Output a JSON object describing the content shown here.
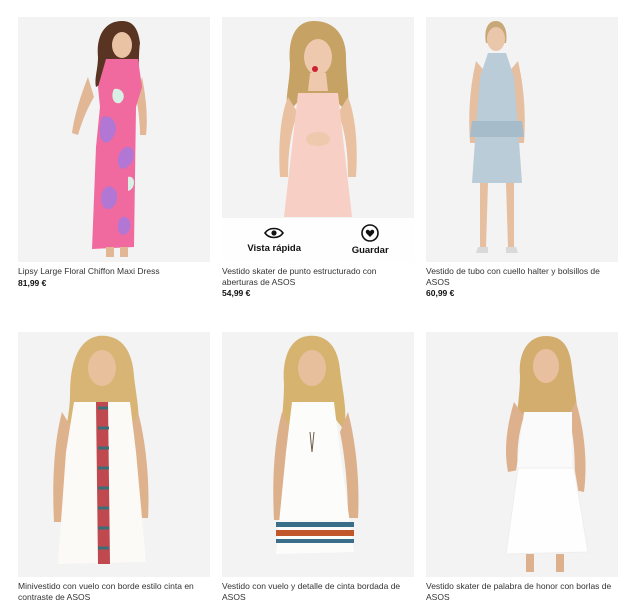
{
  "colors": {
    "page_bg": "#ffffff",
    "image_bg": "#f3f3f3",
    "price": "#111111"
  },
  "overlay": {
    "quick_view_label": "Vista rápida",
    "save_label": "Guardar",
    "quick_view_icon": "eye-icon",
    "save_icon": "heart-icon"
  },
  "products": [
    {
      "title": "Lipsy Large Floral Chiffon Maxi Dress",
      "price": "81,99 €",
      "dress_color": "pink-floral"
    },
    {
      "title": "Vestido skater de punto estructurado con aberturas de ASOS",
      "price": "54,99 €",
      "dress_color": "pale-pink"
    },
    {
      "title": "Vestido de tubo con cuello halter y bolsillos de ASOS",
      "price": "60,99 €",
      "dress_color": "pale-blue"
    },
    {
      "title": "Minivestido con vuelo con borde estilo cinta en contraste de ASOS",
      "price": "",
      "dress_color": "white"
    },
    {
      "title": "Vestido con vuelo y detalle de cinta bordada de ASOS",
      "price": "",
      "dress_color": "white"
    },
    {
      "title": "Vestido skater de palabra de honor con borlas de ASOS",
      "price": "",
      "dress_color": "white"
    }
  ]
}
